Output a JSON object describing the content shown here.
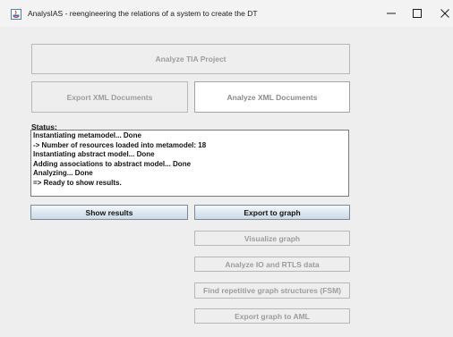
{
  "window": {
    "title": "AnalysIAS - reengineering the relations of a system to create the DT"
  },
  "buttons": {
    "analyze_tia": "Analyze TIA Project",
    "export_xml": "Export XML Documents",
    "analyze_xml": "Analyze XML Documents",
    "show_results": "Show results",
    "export_graph": "Export to graph",
    "visualize_graph": "Visualize graph",
    "analyze_io": "Analyze IO and RTLS data",
    "find_fsm": "Find repetitive graph structures (FSM)",
    "export_aml": "Export graph to AML"
  },
  "status": {
    "label": "Status:",
    "lines": [
      "Instantiating metamodel... Done",
      "-> Number of resources loaded into metamodel: 18",
      "Instantiating abstract model... Done",
      "Adding associations to abstract model... Done",
      "Analyzing... Done",
      "=> Ready to show results."
    ]
  },
  "icons": {
    "app": "java-app-icon",
    "minimize": "minimize-icon",
    "maximize": "maximize-icon",
    "close": "close-icon"
  }
}
